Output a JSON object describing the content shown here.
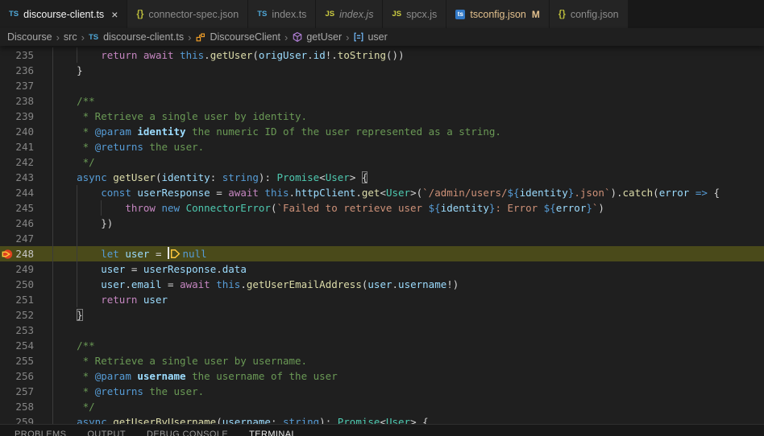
{
  "tabs": [
    {
      "label": "discourse-client.ts",
      "icon": "ts",
      "active": true,
      "close_label": "×"
    },
    {
      "label": "connector-spec.json",
      "icon": "braces"
    },
    {
      "label": "index.ts",
      "icon": "ts"
    },
    {
      "label": "index.js",
      "icon": "js",
      "preview": true
    },
    {
      "label": "spcx.js",
      "icon": "js"
    },
    {
      "label": "tsconfig.json",
      "icon": "tsbox",
      "badge": "M",
      "modified": true
    },
    {
      "label": "config.json",
      "icon": "braces"
    }
  ],
  "breadcrumb": {
    "separator": "›",
    "items": [
      {
        "label": "Discourse"
      },
      {
        "label": "src"
      },
      {
        "label": "discourse-client.ts",
        "icon": "ts"
      },
      {
        "label": "DiscourseClient",
        "icon": "class"
      },
      {
        "label": "getUser",
        "icon": "method"
      },
      {
        "label": "user",
        "icon": "field"
      }
    ]
  },
  "editor": {
    "first_line_number": 235,
    "debug_line": 248,
    "cursor": {
      "line": 248,
      "after_text": "let user = "
    },
    "lines": [
      {
        "n": 235,
        "g": [
          0,
          4
        ],
        "seg": [
          [
            "w",
            "        "
          ],
          [
            "c",
            "return "
          ],
          [
            "c",
            "await "
          ],
          [
            "k",
            "this"
          ],
          [
            "w",
            "."
          ],
          [
            "f",
            "getUser"
          ],
          [
            "w",
            "("
          ],
          [
            "v",
            "origUser"
          ],
          [
            "w",
            "."
          ],
          [
            "v",
            "id"
          ],
          [
            "w",
            "!."
          ],
          [
            "f",
            "toString"
          ],
          [
            "w",
            "())"
          ]
        ]
      },
      {
        "n": 236,
        "g": [
          0
        ],
        "seg": [
          [
            "w",
            "    }"
          ]
        ]
      },
      {
        "n": 237,
        "g": [
          0
        ],
        "seg": []
      },
      {
        "n": 238,
        "g": [
          0
        ],
        "seg": [
          [
            "m",
            "    /**"
          ]
        ]
      },
      {
        "n": 239,
        "g": [
          0
        ],
        "seg": [
          [
            "m",
            "     * Retrieve a single user by identity."
          ]
        ]
      },
      {
        "n": 240,
        "g": [
          0
        ],
        "seg": [
          [
            "m",
            "     * "
          ],
          [
            "k",
            "@param "
          ],
          [
            "vb",
            "identity"
          ],
          [
            "m",
            " the numeric ID of the user represented as a string."
          ]
        ]
      },
      {
        "n": 241,
        "g": [
          0
        ],
        "seg": [
          [
            "m",
            "     * "
          ],
          [
            "k",
            "@returns"
          ],
          [
            "m",
            " the user."
          ]
        ]
      },
      {
        "n": 242,
        "g": [
          0
        ],
        "seg": [
          [
            "m",
            "     */"
          ]
        ]
      },
      {
        "n": 243,
        "g": [
          0
        ],
        "seg": [
          [
            "k",
            "    async "
          ],
          [
            "f",
            "getUser"
          ],
          [
            "w",
            "("
          ],
          [
            "v",
            "identity"
          ],
          [
            "w",
            ": "
          ],
          [
            "k",
            "string"
          ],
          [
            "w",
            "): "
          ],
          [
            "t",
            "Promise"
          ],
          [
            "w",
            "<"
          ],
          [
            "t",
            "User"
          ],
          [
            "w",
            "> "
          ],
          [
            "x",
            "{"
          ]
        ]
      },
      {
        "n": 244,
        "g": [
          0,
          4
        ],
        "seg": [
          [
            "w",
            "        "
          ],
          [
            "k",
            "const "
          ],
          [
            "v",
            "userResponse"
          ],
          [
            "w",
            " = "
          ],
          [
            "c",
            "await "
          ],
          [
            "k",
            "this"
          ],
          [
            "w",
            "."
          ],
          [
            "v",
            "httpClient"
          ],
          [
            "w",
            "."
          ],
          [
            "f",
            "get"
          ],
          [
            "w",
            "<"
          ],
          [
            "t",
            "User"
          ],
          [
            "w",
            ">("
          ],
          [
            "s",
            "`/admin/users/"
          ],
          [
            "k",
            "${"
          ],
          [
            "v",
            "identity"
          ],
          [
            "k",
            "}"
          ],
          [
            "s",
            ".json`"
          ],
          [
            "w",
            ")."
          ],
          [
            "f",
            "catch"
          ],
          [
            "w",
            "("
          ],
          [
            "v",
            "error"
          ],
          [
            "w",
            " "
          ],
          [
            "k",
            "=>"
          ],
          [
            "w",
            " {"
          ]
        ]
      },
      {
        "n": 245,
        "g": [
          0,
          4,
          8
        ],
        "seg": [
          [
            "w",
            "            "
          ],
          [
            "c",
            "throw "
          ],
          [
            "k",
            "new "
          ],
          [
            "t",
            "ConnectorError"
          ],
          [
            "w",
            "("
          ],
          [
            "s",
            "`Failed to retrieve user "
          ],
          [
            "k",
            "${"
          ],
          [
            "v",
            "identity"
          ],
          [
            "k",
            "}"
          ],
          [
            "s",
            ": Error "
          ],
          [
            "k",
            "${"
          ],
          [
            "v",
            "error"
          ],
          [
            "k",
            "}"
          ],
          [
            "s",
            "`"
          ],
          [
            "w",
            ")"
          ]
        ]
      },
      {
        "n": 246,
        "g": [
          0,
          4
        ],
        "seg": [
          [
            "w",
            "        })"
          ]
        ]
      },
      {
        "n": 247,
        "g": [
          0,
          4
        ],
        "seg": []
      },
      {
        "n": 248,
        "g": [
          0,
          4
        ],
        "debug": true,
        "seg": [
          [
            "w",
            "        "
          ],
          [
            "k",
            "let "
          ],
          [
            "v",
            "user"
          ],
          [
            "w",
            " = "
          ],
          [
            "cur",
            ""
          ],
          [
            "dbg",
            ""
          ],
          [
            "k",
            "null"
          ]
        ]
      },
      {
        "n": 249,
        "g": [
          0,
          4
        ],
        "seg": [
          [
            "w",
            "        "
          ],
          [
            "v",
            "user"
          ],
          [
            "w",
            " = "
          ],
          [
            "v",
            "userResponse"
          ],
          [
            "w",
            "."
          ],
          [
            "v",
            "data"
          ]
        ]
      },
      {
        "n": 250,
        "g": [
          0,
          4
        ],
        "seg": [
          [
            "w",
            "        "
          ],
          [
            "v",
            "user"
          ],
          [
            "w",
            "."
          ],
          [
            "v",
            "email"
          ],
          [
            "w",
            " = "
          ],
          [
            "c",
            "await "
          ],
          [
            "k",
            "this"
          ],
          [
            "w",
            "."
          ],
          [
            "f",
            "getUserEmailAddress"
          ],
          [
            "w",
            "("
          ],
          [
            "v",
            "user"
          ],
          [
            "w",
            "."
          ],
          [
            "v",
            "username"
          ],
          [
            "w",
            "!)"
          ]
        ]
      },
      {
        "n": 251,
        "g": [
          0,
          4
        ],
        "seg": [
          [
            "w",
            "        "
          ],
          [
            "c",
            "return "
          ],
          [
            "v",
            "user"
          ]
        ]
      },
      {
        "n": 252,
        "g": [
          0
        ],
        "seg": [
          [
            "w",
            "    "
          ],
          [
            "x",
            "}"
          ]
        ]
      },
      {
        "n": 253,
        "g": [
          0
        ],
        "seg": []
      },
      {
        "n": 254,
        "g": [
          0
        ],
        "seg": [
          [
            "m",
            "    /**"
          ]
        ]
      },
      {
        "n": 255,
        "g": [
          0
        ],
        "seg": [
          [
            "m",
            "     * Retrieve a single user by username."
          ]
        ]
      },
      {
        "n": 256,
        "g": [
          0
        ],
        "seg": [
          [
            "m",
            "     * "
          ],
          [
            "k",
            "@param "
          ],
          [
            "vb",
            "username"
          ],
          [
            "m",
            " the username of the user"
          ]
        ]
      },
      {
        "n": 257,
        "g": [
          0
        ],
        "seg": [
          [
            "m",
            "     * "
          ],
          [
            "k",
            "@returns"
          ],
          [
            "m",
            " the user."
          ]
        ]
      },
      {
        "n": 258,
        "g": [
          0
        ],
        "seg": [
          [
            "m",
            "     */"
          ]
        ]
      },
      {
        "n": 259,
        "g": [
          0
        ],
        "seg": [
          [
            "k",
            "    async "
          ],
          [
            "f",
            "getUserByUsername"
          ],
          [
            "w",
            "("
          ],
          [
            "v",
            "username"
          ],
          [
            "w",
            ": "
          ],
          [
            "k",
            "string"
          ],
          [
            "w",
            "): "
          ],
          [
            "t",
            "Promise"
          ],
          [
            "w",
            "<"
          ],
          [
            "t",
            "User"
          ],
          [
            "w",
            "> {"
          ]
        ]
      }
    ]
  },
  "panel": {
    "tabs": [
      {
        "label": "PROBLEMS"
      },
      {
        "label": "OUTPUT"
      },
      {
        "label": "DEBUG CONSOLE"
      },
      {
        "label": "TERMINAL",
        "active": true
      }
    ]
  },
  "colors": {
    "keyword": "#569cd6",
    "control": "#c586c0",
    "function": "#dcdcaa",
    "type": "#4ec9b0",
    "variable": "#9cdcfe",
    "string": "#ce9178",
    "comment": "#6a9955",
    "debug_line_bg": "#4a4a1a",
    "breakpoint_red": "#e0421f",
    "debug_arrow_yellow": "#ffc83d",
    "modified_badge": "#e2c08d",
    "ts_icon": "#4fa8d8",
    "js_icon": "#cbcb41",
    "json_braces_icon": "#b8b93b",
    "class_icon": "#ee9d28",
    "method_icon": "#b180d7",
    "field_icon": "#75beff"
  }
}
